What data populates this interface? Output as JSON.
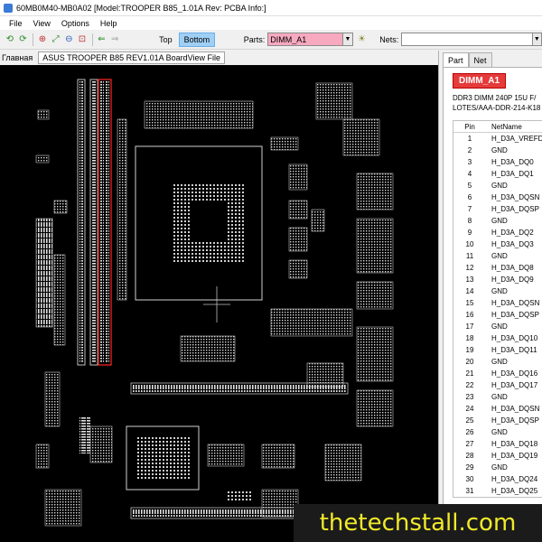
{
  "window": {
    "title": "60MB0M40-MB0A02 [Model:TROOPER B85_1.01A Rev: PCBA Info:]"
  },
  "menu": [
    "File",
    "View",
    "Options",
    "Help"
  ],
  "toolbar": {
    "side_top": "Top",
    "side_bottom": "Bottom",
    "parts_label": "Parts:",
    "parts_value": "DIMM_A1",
    "nets_label": "Nets:",
    "nets_value": ""
  },
  "tabs": {
    "main_label": "Главная",
    "file_tab": "ASUS TROOPER B85 REV1.01A BoardView File"
  },
  "panel": {
    "tabs": [
      "Part",
      "Net"
    ],
    "part_name": "DIMM_A1",
    "desc_line1": "DDR3 DIMM 240P 15U F/",
    "desc_line2": "LOTES/AAA-DDR-214-K18",
    "col_pin": "Pin",
    "col_net": "NetName",
    "rows": [
      {
        "pin": "1",
        "net": "H_D3A_VREFD"
      },
      {
        "pin": "2",
        "net": "GND"
      },
      {
        "pin": "3",
        "net": "H_D3A_DQ0"
      },
      {
        "pin": "4",
        "net": "H_D3A_DQ1"
      },
      {
        "pin": "5",
        "net": "GND"
      },
      {
        "pin": "6",
        "net": "H_D3A_DQSN"
      },
      {
        "pin": "7",
        "net": "H_D3A_DQSP"
      },
      {
        "pin": "8",
        "net": "GND"
      },
      {
        "pin": "9",
        "net": "H_D3A_DQ2"
      },
      {
        "pin": "10",
        "net": "H_D3A_DQ3"
      },
      {
        "pin": "11",
        "net": "GND"
      },
      {
        "pin": "12",
        "net": "H_D3A_DQ8"
      },
      {
        "pin": "13",
        "net": "H_D3A_DQ9"
      },
      {
        "pin": "14",
        "net": "GND"
      },
      {
        "pin": "15",
        "net": "H_D3A_DQSN"
      },
      {
        "pin": "16",
        "net": "H_D3A_DQSP"
      },
      {
        "pin": "17",
        "net": "GND"
      },
      {
        "pin": "18",
        "net": "H_D3A_DQ10"
      },
      {
        "pin": "19",
        "net": "H_D3A_DQ11"
      },
      {
        "pin": "20",
        "net": "GND"
      },
      {
        "pin": "21",
        "net": "H_D3A_DQ16"
      },
      {
        "pin": "22",
        "net": "H_D3A_DQ17"
      },
      {
        "pin": "23",
        "net": "GND"
      },
      {
        "pin": "24",
        "net": "H_D3A_DQSN"
      },
      {
        "pin": "25",
        "net": "H_D3A_DQSP"
      },
      {
        "pin": "26",
        "net": "GND"
      },
      {
        "pin": "27",
        "net": "H_D3A_DQ18"
      },
      {
        "pin": "28",
        "net": "H_D3A_DQ19"
      },
      {
        "pin": "29",
        "net": "GND"
      },
      {
        "pin": "30",
        "net": "H_D3A_DQ24"
      },
      {
        "pin": "31",
        "net": "H_D3A_DQ25"
      }
    ]
  },
  "watermark": "thetechstall.com"
}
